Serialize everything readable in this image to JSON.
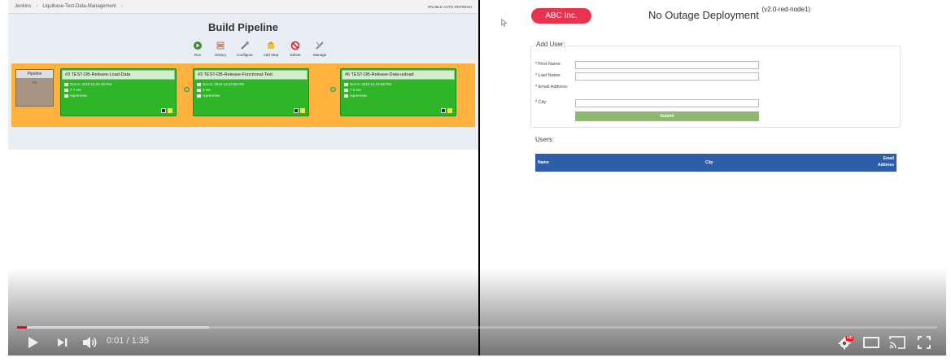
{
  "jenkins": {
    "breadcrumb": [
      "Jenkins",
      "Liquibase-Test-Data-Management"
    ],
    "auto_refresh": "ENABLE AUTO REFRESH",
    "title": "Build Pipeline",
    "toolbar": [
      {
        "label": "Run",
        "icon": "run-icon"
      },
      {
        "label": "History",
        "icon": "history-icon"
      },
      {
        "label": "Configure",
        "icon": "configure-icon"
      },
      {
        "label": "Add Step",
        "icon": "add-step-icon"
      },
      {
        "label": "Delete",
        "icon": "delete-icon"
      },
      {
        "label": "Manage",
        "icon": "manage-icon"
      }
    ],
    "pipeline_label": "Pipeline",
    "pipeline_num": "#3",
    "stages": [
      {
        "title": "#3 TEST-DB-Release-Load-Data",
        "date": "Nov 8, 2018 12:22:46 PM",
        "duration": "7.7 sec",
        "user": "rsprerestw"
      },
      {
        "title": "#3 TEST-DB-Release-Functional-Test",
        "date": "Nov 8, 2018 12:22:56 PM",
        "duration": "3 ms",
        "user": "rsprerestw"
      },
      {
        "title": "#6 TEST-DB-Release-Data-unload",
        "date": "Nov 8, 2018 12:22:58 PM",
        "duration": "7.3 sec",
        "user": "rsprerestw"
      }
    ],
    "colors": {
      "stage_green": "#2fb528",
      "pipeline_bg": "#ffb23d"
    }
  },
  "app": {
    "company": "ABC Inc.",
    "title": "No Outage Deployment",
    "version": "(v2.0-red-node1)",
    "form_legend": "Add User:",
    "fields": {
      "first_name": "* First Name:",
      "last_name": "* Last Name:",
      "email": "* Email Address:",
      "city": "* City:"
    },
    "submit": "Submit",
    "users_title": "Users:",
    "table_headers": {
      "name": "Name",
      "city": "City",
      "email": "Email Address"
    },
    "colors": {
      "brand_red": "#e8334e",
      "table_blue": "#2f5ea8",
      "submit_green": "#8fb870"
    }
  },
  "player": {
    "time": "0:01 / 1:35",
    "progress_fraction": 0.009,
    "buffered_fraction": 0.209,
    "hd_badge": "HD",
    "controls": [
      "play-icon",
      "next-icon",
      "volume-icon",
      "settings-icon",
      "theater-mode-icon",
      "cast-icon",
      "fullscreen-icon"
    ]
  }
}
